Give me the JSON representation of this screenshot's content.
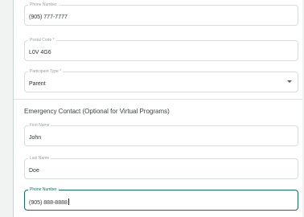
{
  "form": {
    "phone": {
      "label": "Phone Number",
      "value": "(905) 777-7777"
    },
    "postal": {
      "label": "Postal Code *",
      "value": "L0V 4G6"
    },
    "participant_type": {
      "label": "Participant Type *",
      "value": "Parent",
      "icon": "chevron-down-icon"
    }
  },
  "emergency": {
    "title": "Emergency Contact (Optional for Virtual Programs)",
    "first_name": {
      "label": "First Name",
      "value": "John"
    },
    "last_name": {
      "label": "Last Name",
      "value": "Doe"
    },
    "phone": {
      "label": "Phone Number",
      "value": "(905) 888-8888"
    }
  },
  "colors": {
    "focus_accent": "#0d6f6a",
    "border": "#d9dcdc"
  }
}
